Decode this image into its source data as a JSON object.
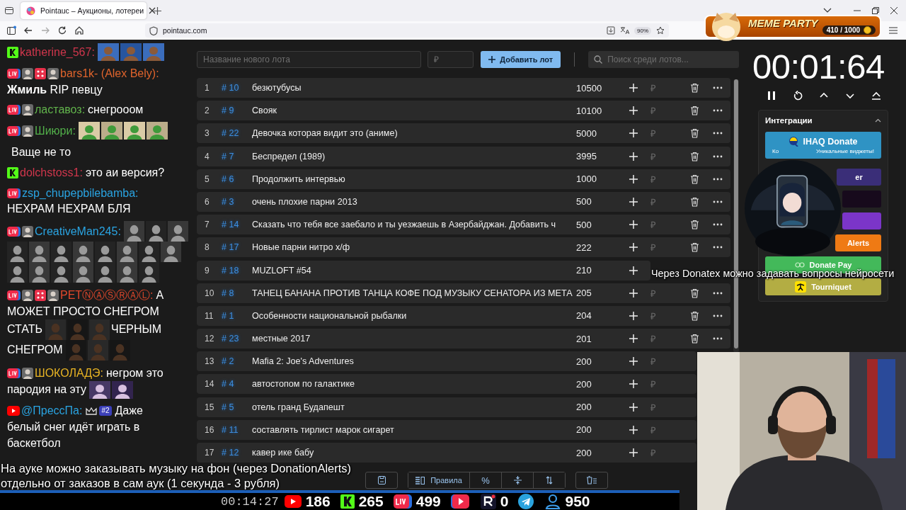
{
  "browser": {
    "tab_title": "Pointauc – Аукционы, лотереи",
    "address": "pointauc.com",
    "zoom": "90%"
  },
  "stream_badge": {
    "title": "MEME PARTY",
    "progress": "410 / 1000"
  },
  "chat": [
    {
      "badges": [
        {
          "kind": "kick"
        }
      ],
      "user": "katherine_567:",
      "color": "#d0364c",
      "parts": [
        {
          "kind": "picture"
        },
        {
          "kind": "picture"
        },
        {
          "kind": "picture"
        }
      ]
    },
    {
      "badges": [
        {
          "kind": "live"
        },
        {
          "kind": "picture"
        },
        {
          "kind": "dice"
        },
        {
          "kind": "picture"
        }
      ],
      "user": "bars1k- (Alex Bely):",
      "color": "#e0642c",
      "parts": [
        {
          "kind": "text",
          "text": "**Жмиль** RIP певцу"
        }
      ]
    },
    {
      "badges": [
        {
          "kind": "live"
        },
        {
          "kind": "picture"
        }
      ],
      "user": "ластавоз:",
      "color": "#62b44c",
      "parts": [
        {
          "kind": "text",
          "text": "снегрооом"
        }
      ]
    },
    {
      "badges": [
        {
          "kind": "live"
        },
        {
          "kind": "picture"
        }
      ],
      "user": "Шиюри:",
      "color": "#52b04a",
      "parts": [
        {
          "kind": "picture"
        },
        {
          "kind": "picture"
        },
        {
          "kind": "picture"
        },
        {
          "kind": "picture"
        }
      ]
    },
    {
      "parts": [
        {
          "kind": "text",
          "text": "Ваще не то"
        }
      ]
    },
    {
      "badges": [
        {
          "kind": "kick"
        }
      ],
      "user": "dolchstoss1:",
      "color": "#d0364c",
      "parts": [
        {
          "kind": "text",
          "text": "это аи версия?"
        }
      ]
    },
    {
      "badges": [
        {
          "kind": "live"
        }
      ],
      "user": "zsp_chupepbilebamba:",
      "color": "#2aa4e2",
      "parts": [
        {
          "kind": "text",
          "text": "НЕХРАМ НЕХРАМ БЛЯ"
        }
      ]
    },
    {
      "badges": [
        {
          "kind": "live"
        },
        {
          "kind": "picture"
        }
      ],
      "user": "CreativeMan245:",
      "color": "#2aa4e2",
      "parts": [
        {
          "kind": "picture"
        },
        {
          "kind": "picture"
        },
        {
          "kind": "picture"
        },
        {
          "kind": "picture"
        },
        {
          "kind": "picture"
        },
        {
          "kind": "picture"
        },
        {
          "kind": "picture"
        },
        {
          "kind": "picture"
        },
        {
          "kind": "picture"
        },
        {
          "kind": "picture"
        },
        {
          "kind": "picture"
        },
        {
          "kind": "picture"
        },
        {
          "kind": "picture"
        },
        {
          "kind": "picture"
        },
        {
          "kind": "picture"
        },
        {
          "kind": "picture"
        },
        {
          "kind": "picture"
        },
        {
          "kind": "picture"
        }
      ]
    },
    {
      "badges": [
        {
          "kind": "live"
        },
        {
          "kind": "picture"
        },
        {
          "kind": "dice"
        },
        {
          "kind": "picture"
        }
      ],
      "user": "PETⓃⒶⓈⓇⒶⓁ:",
      "color": "#e2482c",
      "parts": [
        {
          "kind": "text",
          "text": "А"
        },
        {
          "kind": "text",
          "text": "МОЖЕТ ПРОСТО СНЕГРОМ"
        },
        {
          "kind": "text",
          "text": "СТАТЬ"
        },
        {
          "kind": "picture"
        },
        {
          "kind": "picture"
        },
        {
          "kind": "picture"
        },
        {
          "kind": "text",
          "text": "ЧЕРНЫМ"
        },
        {
          "kind": "text",
          "text": "СНЕГРОМ"
        },
        {
          "kind": "picture"
        },
        {
          "kind": "picture"
        },
        {
          "kind": "picture"
        }
      ]
    },
    {
      "badges": [
        {
          "kind": "live"
        },
        {
          "kind": "picture"
        }
      ],
      "user": "ШОКОЛАДЭ:",
      "color": "#e8b424",
      "parts": [
        {
          "kind": "text",
          "text": "негром это"
        },
        {
          "kind": "text",
          "text": "пародия на эту"
        },
        {
          "kind": "picture"
        },
        {
          "kind": "picture"
        }
      ]
    },
    {
      "badges": [
        {
          "kind": "youtube"
        }
      ],
      "user": "@ПрессПа:",
      "color": "#2aa4e2",
      "parts": [
        {
          "kind": "crown"
        },
        {
          "kind": "rank",
          "text": "#2"
        },
        {
          "kind": "text",
          "text": "Даже"
        },
        {
          "kind": "text",
          "text": "белый снег идёт играть в"
        },
        {
          "kind": "text",
          "text": "баскетбол"
        }
      ]
    }
  ],
  "auction": {
    "name_placeholder": "Название нового лота",
    "price_placeholder": "₽",
    "add_button": "Добавить лот",
    "search_placeholder": "Поиск среди лотов...",
    "rows": [
      {
        "index": "1",
        "id": "# 10",
        "name": "безютубусы",
        "amount": "10500",
        "currency": "₽",
        "actions": true
      },
      {
        "index": "2",
        "id": "# 9",
        "name": "Свояк",
        "amount": "10100",
        "currency": "₽",
        "actions": true
      },
      {
        "index": "3",
        "id": "# 22",
        "name": "Девочка которая видит это (аниме)",
        "amount": "5000",
        "currency": "₽",
        "actions": true
      },
      {
        "index": "4",
        "id": "# 7",
        "name": "Беспредел (1989)",
        "amount": "3995",
        "currency": "₽",
        "actions": true
      },
      {
        "index": "5",
        "id": "# 6",
        "name": "Продолжить интервью",
        "amount": "1000",
        "currency": "₽",
        "actions": true
      },
      {
        "index": "6",
        "id": "# 3",
        "name": "очень плохие парни 2013",
        "amount": "500",
        "currency": "₽",
        "actions": true
      },
      {
        "index": "7",
        "id": "# 14",
        "name": "Сказать что тебя все заебало и ты уезжаешь в Азербайджан. Добавить ч",
        "amount": "500",
        "currency": "₽",
        "actions": true
      },
      {
        "index": "8",
        "id": "# 17",
        "name": "Новые парни нитро х/ф",
        "amount": "222",
        "currency": "₽",
        "actions": true
      },
      {
        "index": "9",
        "id": "# 18",
        "name": "MUZLOFT #54",
        "amount": "210",
        "actions": false
      },
      {
        "index": "10",
        "id": "# 8",
        "name": "ТАНЕЦ БАНАНА ПРОТИВ ТАНЦА КОФЕ ПОД МУЗЫКУ СЕНАТОРА ИЗ МЕТА",
        "amount": "205",
        "currency": "₽",
        "actions": true
      },
      {
        "index": "11",
        "id": "# 1",
        "name": "Особенности национальной рыбалки",
        "amount": "204",
        "currency": "₽",
        "actions": true
      },
      {
        "index": "12",
        "id": "# 23",
        "name": "местные 2017",
        "amount": "201",
        "currency": "₽",
        "actions": true
      },
      {
        "index": "13",
        "id": "# 2",
        "name": "Mafia 2: Joe's Adventures",
        "amount": "200",
        "currency": "₽",
        "actions": false
      },
      {
        "index": "14",
        "id": "# 4",
        "name": "автостопом по галактике",
        "amount": "200",
        "currency": "₽",
        "actions": false
      },
      {
        "index": "15",
        "id": "# 5",
        "name": "отель гранд Будапешт",
        "amount": "200",
        "currency": "₽",
        "actions": false
      },
      {
        "index": "16",
        "id": "# 11",
        "name": "составлять тирлист марок сигарет",
        "amount": "200",
        "currency": "₽",
        "actions": false
      },
      {
        "index": "17",
        "id": "# 12",
        "name": "кавер ике бабу",
        "amount": "200",
        "currency": "₽",
        "actions": false
      }
    ],
    "toolbar": {
      "rules_button": "Правила",
      "percent_button": "%"
    }
  },
  "timer": {
    "time": "00:01:64"
  },
  "integrations": {
    "title": "Интеграции",
    "expanded": true,
    "items": [
      {
        "kind": "ihaq",
        "label": "IHAQ Donate",
        "sub_left": "Ко",
        "sub_right": "Уникальные виджеты!",
        "color": "#2f93c4"
      },
      {
        "kind": "plain",
        "label": "er",
        "color": "#3a2e78"
      },
      {
        "kind": "plain",
        "color": "#170a1c"
      },
      {
        "kind": "plain",
        "color": "#7b35c8"
      },
      {
        "kind": "plain",
        "label": "Alerts",
        "color": "#ef7a14"
      },
      {
        "kind": "donatepay",
        "label": "Donate Pay",
        "color": "#43b95a"
      },
      {
        "kind": "tourniquet",
        "label": "Tourniquet",
        "color": "#b3ad43"
      }
    ]
  },
  "caption": "Через Donatex можно задавать вопросы нейросети",
  "subtitles": [
    "На ауке можно заказывать музыку на фон (через DonationAlerts)",
    "отдельно от заказов в сам аук (1 секунда - 3 рубля)"
  ],
  "stats": {
    "uptime": "00:14:27",
    "items": [
      {
        "kind": "youtube",
        "count": "186"
      },
      {
        "kind": "kick",
        "count": "265"
      },
      {
        "kind": "live",
        "count": "499"
      },
      {
        "kind": "rutube"
      },
      {
        "kind": "r",
        "count": "0"
      },
      {
        "kind": "telegram"
      },
      {
        "kind": "viewers",
        "count": "950"
      }
    ]
  }
}
